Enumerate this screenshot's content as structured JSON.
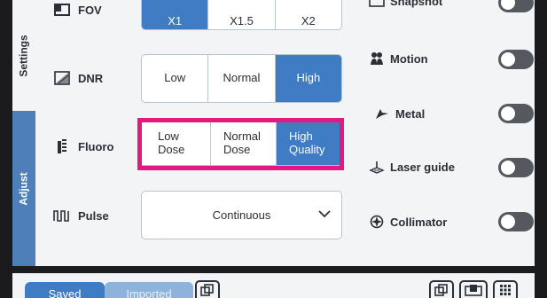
{
  "tabs": {
    "settings": "Settings",
    "adjust": "Adjust"
  },
  "fov": {
    "label": "FOV",
    "options": [
      "X1",
      "X1.5",
      "X2"
    ],
    "selected": "X1"
  },
  "dnr": {
    "label": "DNR",
    "options": [
      "Low",
      "Normal",
      "High"
    ],
    "selected": "High"
  },
  "fluoro": {
    "label": "Fluoro",
    "options": [
      {
        "line1": "Low",
        "line2": "Dose"
      },
      {
        "line1": "Normal",
        "line2": "Dose"
      },
      {
        "line1": "High",
        "line2": "Quality"
      }
    ],
    "selected": "High Quality"
  },
  "pulse": {
    "label": "Pulse",
    "value": "Continuous"
  },
  "toggles": [
    {
      "label": "Snapshot",
      "icon": "snapshot-icon",
      "on": false
    },
    {
      "label": "Motion",
      "icon": "motion-icon",
      "on": false
    },
    {
      "label": "Metal",
      "icon": "metal-icon",
      "on": false
    },
    {
      "label": "Laser guide",
      "icon": "laser-guide-icon",
      "on": false
    },
    {
      "label": "Collimator",
      "icon": "collimator-icon",
      "on": false
    }
  ],
  "bottom": {
    "saved": "Saved",
    "imported": "Imported"
  },
  "colors": {
    "accent": "#3f7cc4",
    "highlight": "#e5187f",
    "toggle_off": "#55595f"
  }
}
